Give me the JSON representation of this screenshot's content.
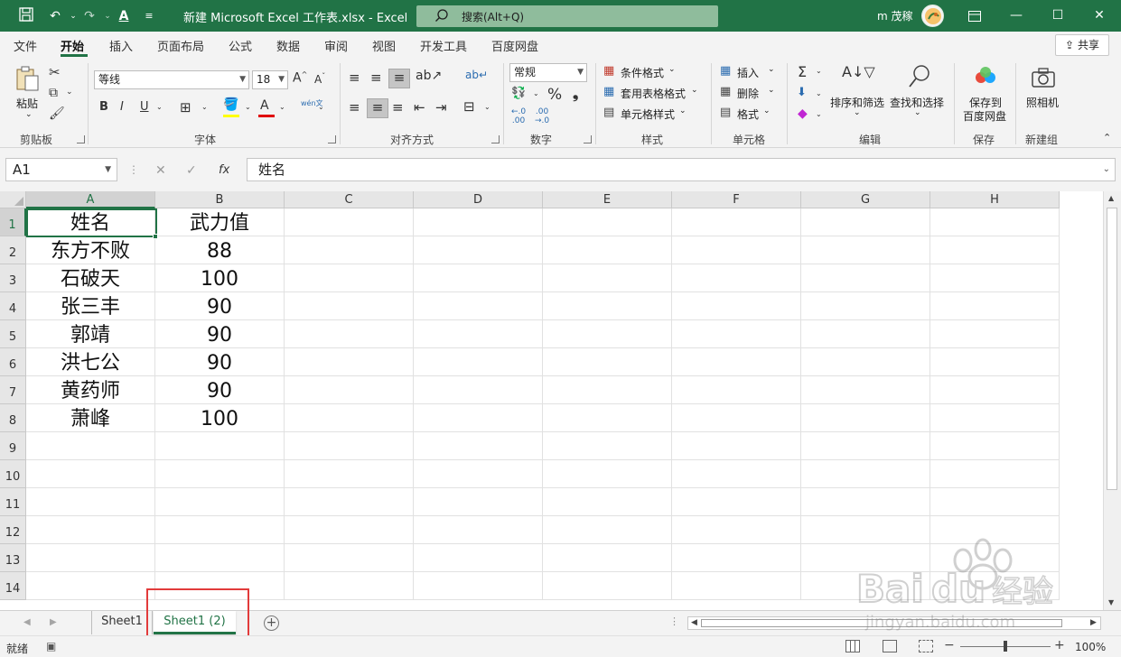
{
  "window": {
    "title": "新建 Microsoft Excel 工作表.xlsx  -  Excel",
    "search_placeholder": "搜索(Alt+Q)",
    "user_name": "m 茂稼"
  },
  "ribbon_tabs": [
    "文件",
    "开始",
    "插入",
    "页面布局",
    "公式",
    "数据",
    "审阅",
    "视图",
    "开发工具",
    "百度网盘"
  ],
  "share_label": "共享",
  "ribbon": {
    "paste_label": "粘贴",
    "font_name": "等线",
    "font_size": "18",
    "phonetic_label": "wén文",
    "number_format": "常规",
    "conditional_format": "条件格式",
    "table_format": "套用表格格式",
    "cell_styles": "单元格样式",
    "insert": "插入",
    "delete": "删除",
    "format": "格式",
    "sort_filter": "排序和筛选",
    "find_select": "查找和选择",
    "save_to_baidu": "保存到",
    "save_to_baidu_2": "百度网盘",
    "camera": "照相机",
    "groups": [
      "剪贴板",
      "字体",
      "对齐方式",
      "数字",
      "样式",
      "单元格",
      "编辑",
      "保存",
      "新建组"
    ]
  },
  "formula_bar": {
    "name_box": "A1",
    "formula": "姓名"
  },
  "columns": [
    "A",
    "B",
    "C",
    "D",
    "E",
    "F",
    "G",
    "H"
  ],
  "rows": [
    "1",
    "2",
    "3",
    "4",
    "5",
    "6",
    "7",
    "8",
    "9",
    "10",
    "11",
    "12",
    "13",
    "14"
  ],
  "cells": [
    [
      "姓名",
      "武力值"
    ],
    [
      "东方不败",
      "88"
    ],
    [
      "石破天",
      "100"
    ],
    [
      "张三丰",
      "90"
    ],
    [
      "郭靖",
      "90"
    ],
    [
      "洪七公",
      "90"
    ],
    [
      "黄药师",
      "90"
    ],
    [
      "萧峰",
      "100"
    ]
  ],
  "sheets": [
    "Sheet1",
    "Sheet1 (2)"
  ],
  "status": {
    "ready": "就绪",
    "zoom": "100%"
  },
  "watermark": {
    "brand": "Bai",
    "brand2": "du",
    "site_cn": "经验",
    "url": "jingyan.baidu.com"
  },
  "colors": {
    "excel_green": "#217346",
    "highlight_red": "#e23b3b"
  }
}
